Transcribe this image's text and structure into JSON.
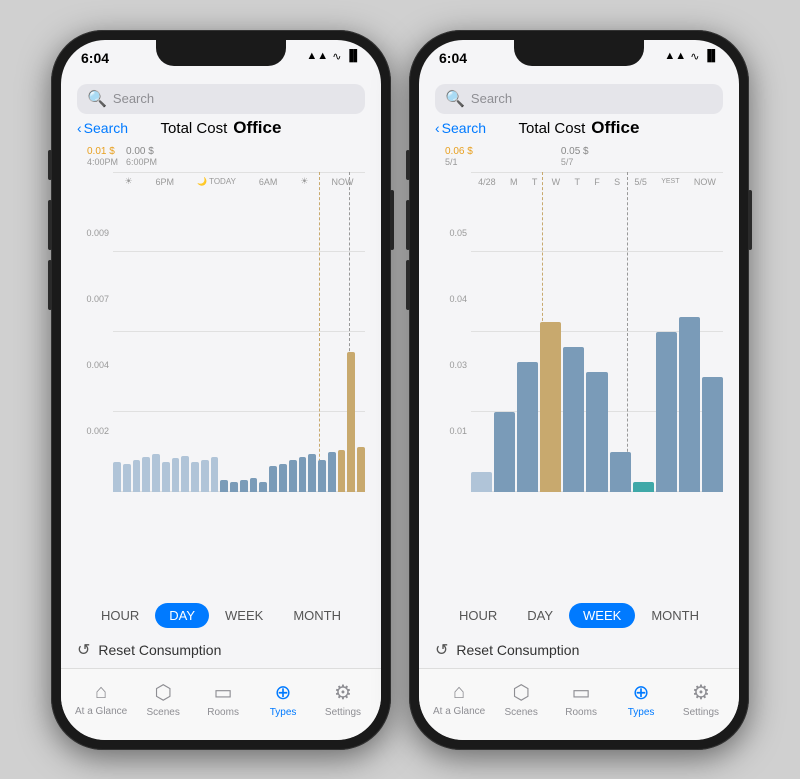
{
  "phone1": {
    "status": {
      "time": "6:04",
      "time_icon": "✈",
      "signal": "●●●",
      "wifi": "wifi",
      "battery": "battery"
    },
    "nav": {
      "back_label": "Search",
      "left_title": "Total Cost",
      "right_title": "Office"
    },
    "chart": {
      "mode": "DAY",
      "tooltip_orange": "0.01 $",
      "tooltip_orange_sub": "4:00PM",
      "tooltip_gray": "0.00 $",
      "tooltip_gray_sub": "6:00PM",
      "y_labels": [
        "0.009",
        "0.007",
        "0.004",
        "0.002"
      ],
      "x_labels": [
        "☀",
        "6PM",
        "🌙 TODAY",
        "6AM",
        "☀",
        "NOW"
      ],
      "bars": [
        {
          "height": 30,
          "type": "blue-light"
        },
        {
          "height": 28,
          "type": "blue-light"
        },
        {
          "height": 32,
          "type": "blue-light"
        },
        {
          "height": 35,
          "type": "blue-light"
        },
        {
          "height": 38,
          "type": "blue-light"
        },
        {
          "height": 30,
          "type": "blue-light"
        },
        {
          "height": 34,
          "type": "blue-light"
        },
        {
          "height": 36,
          "type": "blue-light"
        },
        {
          "height": 30,
          "type": "blue-light"
        },
        {
          "height": 32,
          "type": "blue-light"
        },
        {
          "height": 35,
          "type": "blue-light"
        },
        {
          "height": 12,
          "type": "blue"
        },
        {
          "height": 10,
          "type": "blue"
        },
        {
          "height": 12,
          "type": "blue"
        },
        {
          "height": 14,
          "type": "blue"
        },
        {
          "height": 10,
          "type": "blue"
        },
        {
          "height": 26,
          "type": "blue"
        },
        {
          "height": 28,
          "type": "blue"
        },
        {
          "height": 32,
          "type": "blue"
        },
        {
          "height": 35,
          "type": "blue"
        },
        {
          "height": 38,
          "type": "blue"
        },
        {
          "height": 32,
          "type": "blue"
        },
        {
          "height": 40,
          "type": "blue"
        },
        {
          "height": 42,
          "type": "gold"
        },
        {
          "height": 140,
          "type": "gold"
        },
        {
          "height": 45,
          "type": "gold"
        }
      ]
    },
    "time_controls": [
      "HOUR",
      "DAY",
      "WEEK",
      "MONTH"
    ],
    "active_control": "DAY",
    "reset_label": "Reset Consumption",
    "tabs": [
      {
        "icon": "⌂",
        "label": "At a Glance",
        "active": false
      },
      {
        "icon": "⬡",
        "label": "Scenes",
        "active": false
      },
      {
        "icon": "▭",
        "label": "Rooms",
        "active": false
      },
      {
        "icon": "◈",
        "label": "Types",
        "active": true
      },
      {
        "icon": "⚙",
        "label": "Settings",
        "active": false
      }
    ]
  },
  "phone2": {
    "status": {
      "time": "6:04",
      "time_icon": "✈"
    },
    "nav": {
      "back_label": "Search",
      "left_title": "Total Cost",
      "right_title": "Office"
    },
    "chart": {
      "mode": "WEEK",
      "tooltip_orange": "0.06 $",
      "tooltip_orange_sub": "5/1",
      "tooltip_gray": "0.05 $",
      "tooltip_gray_sub": "5/7",
      "y_labels": [
        "0.05",
        "0.04",
        "0.03",
        "0.01"
      ],
      "x_labels": [
        "4/28",
        "M",
        "T",
        "W",
        "T",
        "F",
        "S",
        "5/5",
        "YESTERDAY",
        "NOW"
      ],
      "bars": [
        {
          "height": 20,
          "type": "blue-light"
        },
        {
          "height": 80,
          "type": "blue"
        },
        {
          "height": 130,
          "type": "blue"
        },
        {
          "height": 170,
          "type": "gold"
        },
        {
          "height": 145,
          "type": "blue"
        },
        {
          "height": 120,
          "type": "blue"
        },
        {
          "height": 40,
          "type": "blue"
        },
        {
          "height": 10,
          "type": "teal"
        },
        {
          "height": 160,
          "type": "blue"
        },
        {
          "height": 175,
          "type": "blue"
        },
        {
          "height": 115,
          "type": "blue"
        }
      ]
    },
    "time_controls": [
      "HOUR",
      "DAY",
      "WEEK",
      "MONTH"
    ],
    "active_control": "WEEK",
    "reset_label": "Reset Consumption",
    "tabs": [
      {
        "icon": "⌂",
        "label": "At a Glance",
        "active": false
      },
      {
        "icon": "⬡",
        "label": "Scenes",
        "active": false
      },
      {
        "icon": "▭",
        "label": "Rooms",
        "active": false
      },
      {
        "icon": "◈",
        "label": "Types",
        "active": true
      },
      {
        "icon": "⚙",
        "label": "Settings",
        "active": false
      }
    ]
  }
}
